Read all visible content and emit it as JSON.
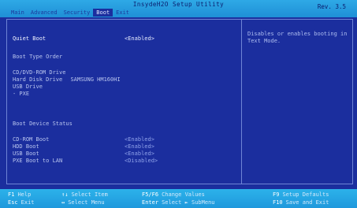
{
  "header": {
    "title": "InsydeH2O Setup Utility",
    "revision": "Rev. 3.5",
    "tabs": [
      "Main",
      "Advanced",
      "Security",
      "Boot",
      "Exit"
    ],
    "active_tab": "Boot"
  },
  "boot": {
    "quiet_boot": {
      "label": "Quiet Boot",
      "value": "<Enabled>"
    },
    "boot_type_order_heading": "Boot Type Order",
    "order": [
      "CD/DVD-ROM Drive",
      "Hard Disk Drive",
      "USB Drive",
      "- PXE"
    ],
    "hdd_model": "SAMSUNG HM160HI",
    "device_status_heading": "Boot Device Status",
    "devices": [
      {
        "label": "CD-ROM Boot",
        "value": "<Enabled>"
      },
      {
        "label": "HDD Boot",
        "value": "<Enabled>"
      },
      {
        "label": "USB Boot",
        "value": "<Enabled>"
      },
      {
        "label": "PXE Boot to LAN",
        "value": "<Disabled>"
      }
    ]
  },
  "help": {
    "text": "Disables or enables booting in Text Mode."
  },
  "footer": {
    "keys": [
      {
        "key": "F1",
        "desc": "Help"
      },
      {
        "key": "Esc",
        "desc": "Exit"
      },
      {
        "key": "↑↓",
        "desc": "Select Item"
      },
      {
        "key": "↔",
        "desc": "Select Menu"
      },
      {
        "key": "F5/F6",
        "desc": "Change Values"
      },
      {
        "key": "Enter",
        "desc": "Select ► SubMenu"
      },
      {
        "key": "F9",
        "desc": "Setup Defaults"
      },
      {
        "key": "F10",
        "desc": "Save and Exit"
      }
    ]
  },
  "colors": {
    "background": "#1b2e9e",
    "bar": "#2ea9e6",
    "highlight": "#f2f5ff",
    "value": "#8fa2ea"
  }
}
